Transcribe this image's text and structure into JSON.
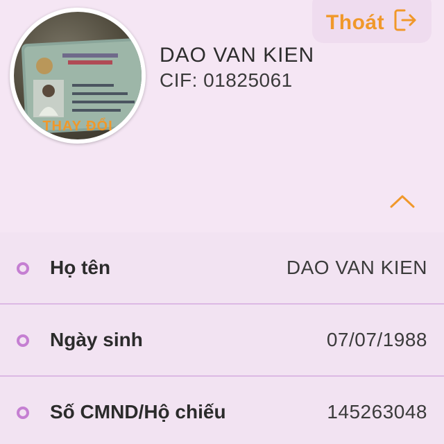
{
  "header": {
    "logout_label": "Thoát",
    "logout_icon": "logout-icon",
    "accent_color": "#f0982a"
  },
  "profile": {
    "avatar_change_label": "THAY ĐỔI",
    "name": "DAO VAN KIEN",
    "cif": "CIF: 01825061"
  },
  "details": {
    "collapse_icon": "chevron-up-icon",
    "rows": [
      {
        "label": "Họ tên",
        "value": "DAO VAN KIEN"
      },
      {
        "label": "Ngày sinh",
        "value": "07/07/1988"
      },
      {
        "label": "Số CMND/Hộ chiếu",
        "value": "145263048"
      }
    ]
  }
}
